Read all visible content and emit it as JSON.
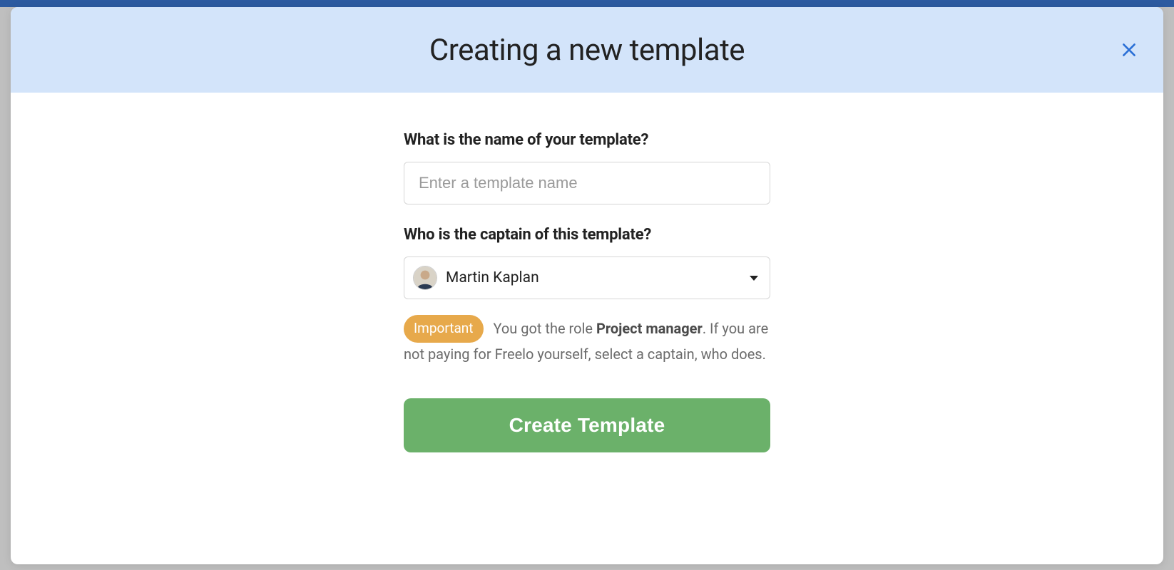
{
  "modal": {
    "title": "Creating a new template",
    "close_icon": "close"
  },
  "form": {
    "name_label": "What is the name of your template?",
    "name_placeholder": "Enter a template name",
    "name_value": "",
    "captain_label": "Who is the captain of this template?",
    "captain_selected": "Martin Kaplan",
    "note_badge": "Important",
    "note_prefix": "You got the role ",
    "note_role": "Project manager",
    "note_suffix": ". If you are not paying for Freelo yourself, select a captain, who does.",
    "submit_label": "Create Template"
  }
}
